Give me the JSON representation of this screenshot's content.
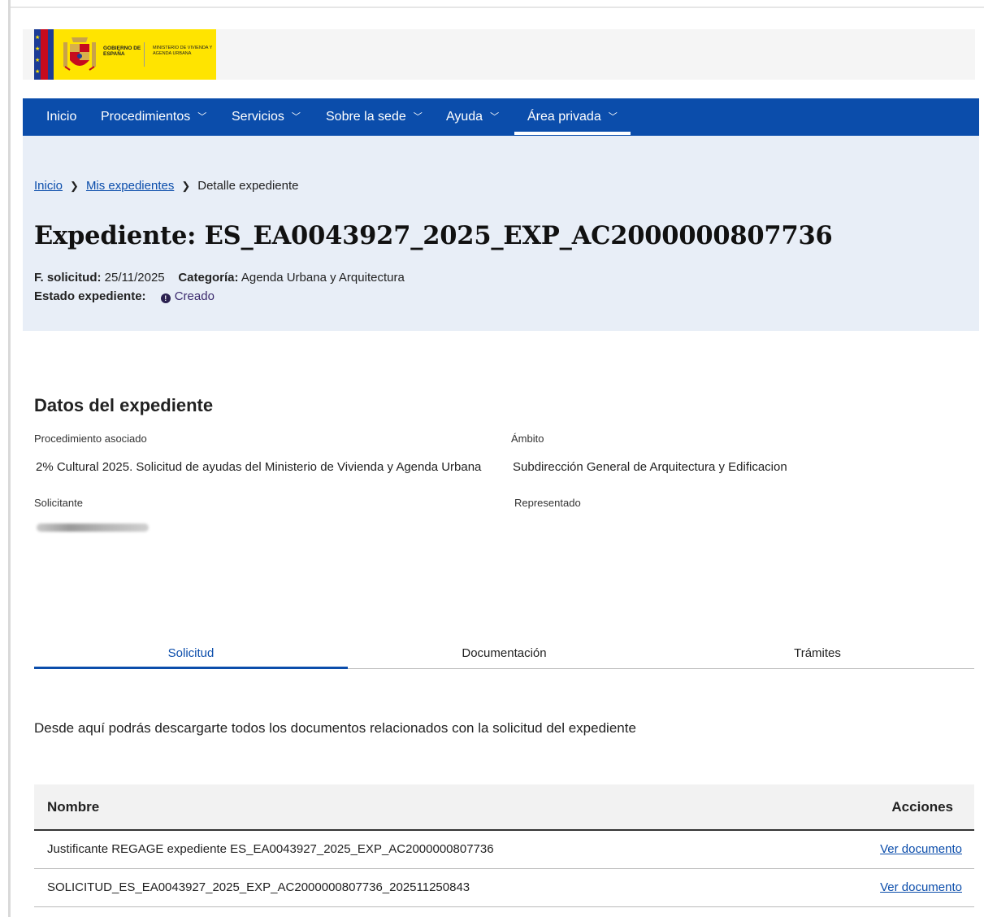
{
  "header": {
    "gov_text": "GOBIERNO DE ESPAÑA",
    "ministry_text": "MINISTERIO DE VIVIENDA Y AGENDA URBANA"
  },
  "nav": {
    "items": [
      {
        "label": "Inicio"
      },
      {
        "label": "Procedimientos"
      },
      {
        "label": "Servicios"
      },
      {
        "label": "Sobre la sede"
      },
      {
        "label": "Ayuda"
      },
      {
        "label": "Área privada"
      }
    ],
    "active": "Área privada"
  },
  "breadcrumb": {
    "items": [
      "Inicio",
      "Mis expedientes",
      "Detalle expediente"
    ]
  },
  "page": {
    "title": "Expediente: ES_EA0043927_2025_EXP_AC2000000807736",
    "fecha_label": "F. solicitud:",
    "fecha_value": "25/11/2025",
    "categoria_label": "Categoría:",
    "categoria_value": "Agenda Urbana y Arquitectura",
    "estado_label": "Estado expediente:",
    "estado_value": "Creado"
  },
  "datos": {
    "heading": "Datos del expediente",
    "procedimiento_label": "Procedimiento asociado",
    "procedimiento_value": "2% Cultural 2025. Solicitud de ayudas del Ministerio de Vivienda y Agenda Urbana",
    "ambito_label": "Ámbito",
    "ambito_value": "Subdirección General de Arquitectura y Edificacion",
    "solicitante_label": "Solicitante",
    "representado_label": "Representado"
  },
  "tabs": [
    {
      "label": "Solicitud",
      "active": true
    },
    {
      "label": "Documentación",
      "active": false
    },
    {
      "label": "Trámites",
      "active": false
    }
  ],
  "intro": "Desde aquí podrás descargarte todos los documentos relacionados con la solicitud del expediente",
  "table": {
    "columns": [
      "Nombre",
      "Acciones"
    ],
    "rows": [
      {
        "nombre": "Justificante REGAGE expediente ES_EA0043927_2025_EXP_AC2000000807736",
        "accion": "Ver documento"
      },
      {
        "nombre": "SOLICITUD_ES_EA0043927_2025_EXP_AC2000000807736_202511250843",
        "accion": "Ver documento"
      }
    ]
  },
  "colors": {
    "primary": "#0b4dab",
    "hero_bg": "#e8eef7",
    "logo_bg": "#ffe400"
  }
}
